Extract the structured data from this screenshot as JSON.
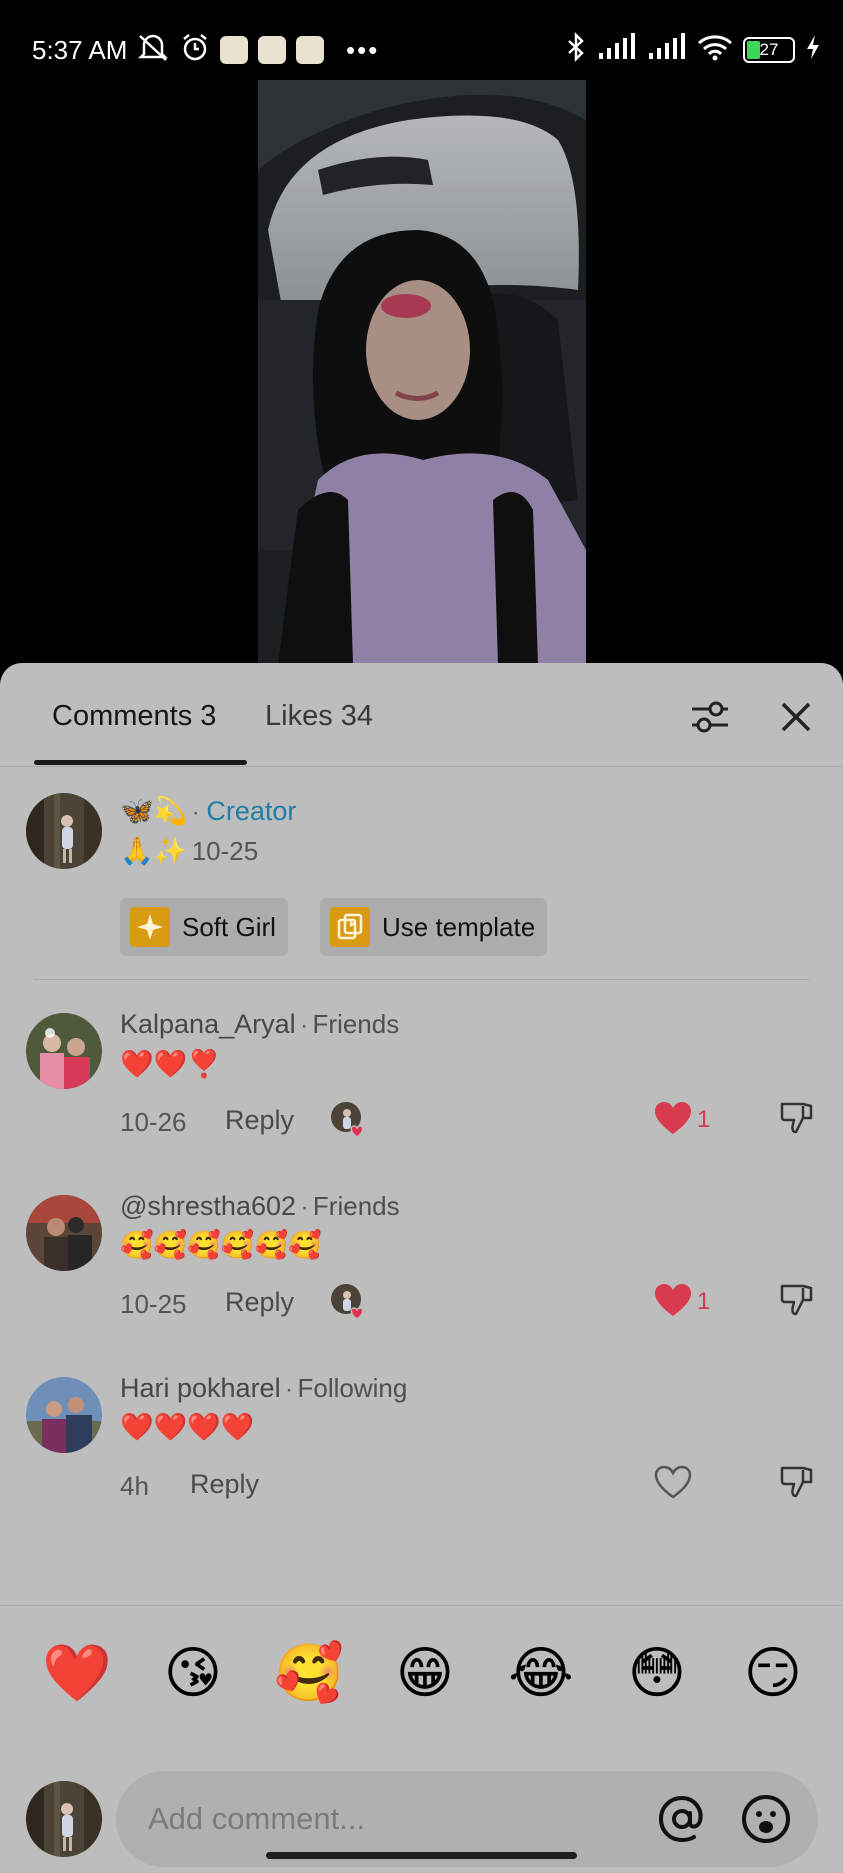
{
  "status_bar": {
    "time": "5:37 AM",
    "battery": "27",
    "left_icons": [
      "mute-icon",
      "alarm-icon",
      "app-icon",
      "download-icon",
      "app-icon"
    ],
    "right_icons": [
      "bluetooth-icon",
      "signal-icon",
      "signal-icon",
      "wifi-icon",
      "battery-icon",
      "charging-icon"
    ]
  },
  "tabs": {
    "comments": "Comments 3",
    "likes": "Likes 34"
  },
  "creator_comment": {
    "emojis": "🦋💫",
    "badge": "Creator",
    "text": "🙏✨",
    "date": "10-25",
    "chips": [
      {
        "label": "Soft Girl",
        "icon": "sparkle-icon"
      },
      {
        "label": "Use template",
        "icon": "template-icon"
      }
    ]
  },
  "comments": [
    {
      "user": "Kalpana_Aryal",
      "relation": "Friends",
      "text": "❤️❤️❣️",
      "date": "10-26",
      "reply": "Reply",
      "likes": "1",
      "liked": true,
      "creator_liked": true
    },
    {
      "user": "@shrestha602",
      "relation": "Friends",
      "text": "🥰🥰🥰🥰🥰🥰",
      "date": "10-25",
      "reply": "Reply",
      "likes": "1",
      "liked": true,
      "creator_liked": true
    },
    {
      "user": "Hari pokharel",
      "relation": "Following",
      "text": "❤️❤️❤️❤️",
      "date": "4h",
      "reply": "Reply",
      "likes": "",
      "liked": false,
      "creator_liked": false
    }
  ],
  "quick_emojis": [
    "❤️",
    "😘",
    "🥰",
    "😁",
    "😂",
    "😳",
    "😏"
  ],
  "input": {
    "placeholder": "Add comment..."
  },
  "colors": {
    "sheet_bg": "#bdbdbd",
    "creator_badge": "#1d7fa6",
    "like_red": "#d83a4e",
    "chip_icon": "#d99a14"
  }
}
